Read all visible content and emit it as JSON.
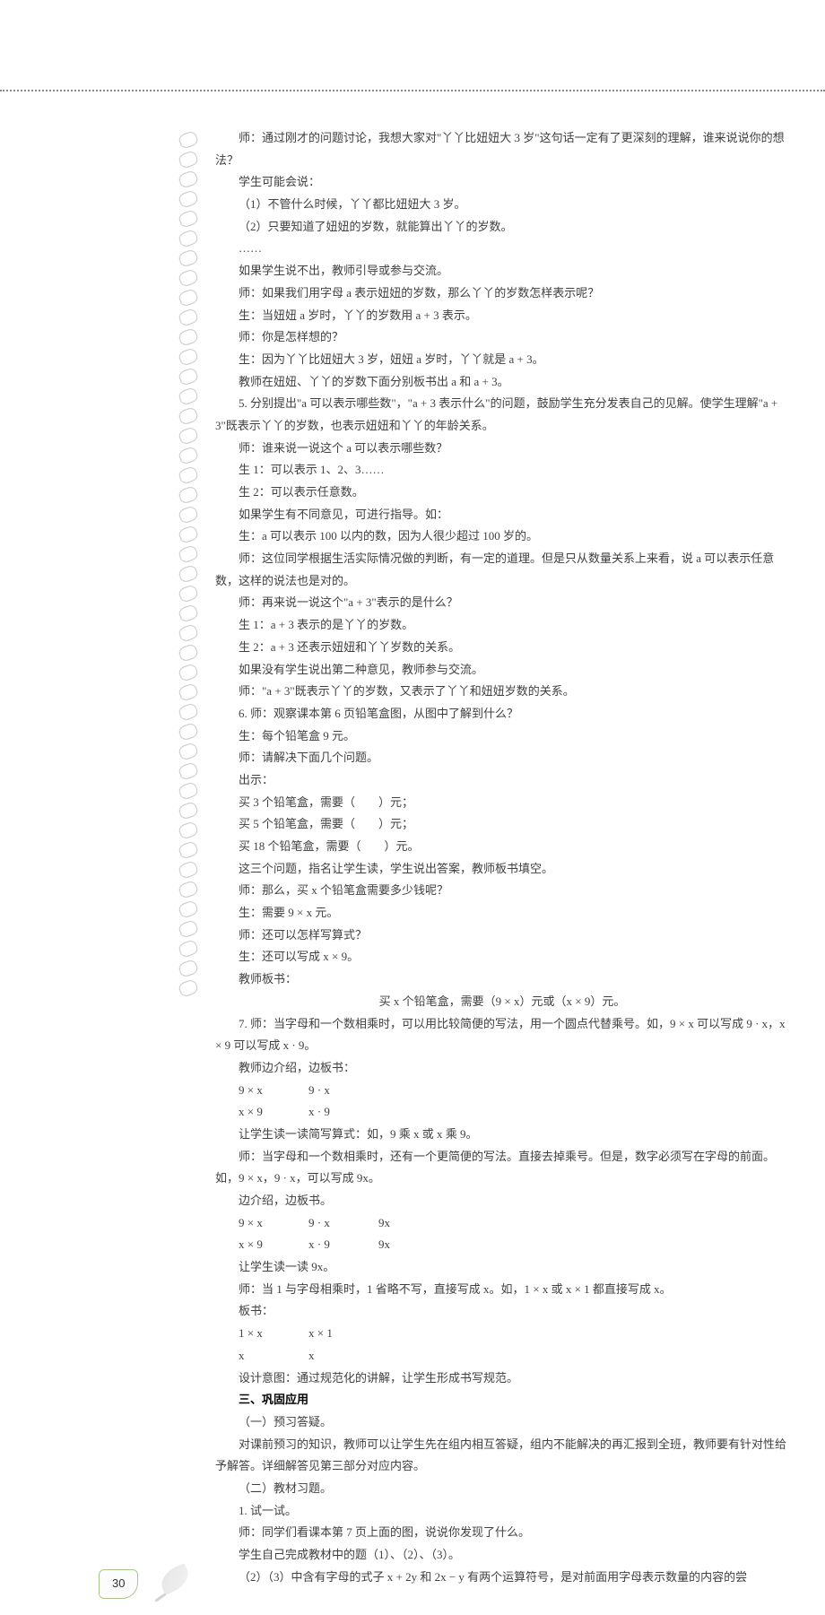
{
  "page_number": "30",
  "lines": {
    "l1": "师：通过刚才的问题讨论，我想大家对\"丫丫比妞妞大 3 岁\"这句话一定有了更深刻的理解，谁来说说你的想法？",
    "l2": "学生可能会说：",
    "l3": "（1）不管什么时候，丫丫都比妞妞大 3 岁。",
    "l4": "（2）只要知道了妞妞的岁数，就能算出丫丫的岁数。",
    "l5": "……",
    "l6": "如果学生说不出，教师引导或参与交流。",
    "l7": "师：如果我们用字母 a 表示妞妞的岁数，那么丫丫的岁数怎样表示呢？",
    "l8": "生：当妞妞 a 岁时，丫丫的岁数用 a + 3 表示。",
    "l9": "师：你是怎样想的？",
    "l10": "生：因为丫丫比妞妞大 3 岁，妞妞 a 岁时，丫丫就是 a + 3。",
    "l11": "教师在妞妞、丫丫的岁数下面分别板书出 a 和 a + 3。",
    "l12": "5. 分别提出\"a 可以表示哪些数\"，\"a + 3 表示什么\"的问题，鼓励学生充分发表自己的见解。使学生理解\"a + 3\"既表示丫丫的岁数，也表示妞妞和丫丫的年龄关系。",
    "l13": "师：谁来说一说这个 a 可以表示哪些数？",
    "l14": "生 1：可以表示 1、2、3……",
    "l15": "生 2：可以表示任意数。",
    "l16": "如果学生有不同意见，可进行指导。如：",
    "l17": "生：a 可以表示 100 以内的数，因为人很少超过 100 岁的。",
    "l18": "师：这位同学根据生活实际情况做的判断，有一定的道理。但是只从数量关系上来看，说 a 可以表示任意数，这样的说法也是对的。",
    "l19": "师：再来说一说这个\"a + 3\"表示的是什么？",
    "l20": "生 1：a + 3 表示的是丫丫的岁数。",
    "l21": "生 2：a + 3 还表示妞妞和丫丫岁数的关系。",
    "l22": "如果没有学生说出第二种意见，教师参与交流。",
    "l23": "师：\"a + 3\"既表示丫丫的岁数，又表示了丫丫和妞妞岁数的关系。",
    "l24": "6. 师：观察课本第 6 页铅笔盒图，从图中了解到什么？",
    "l25": "生：每个铅笔盒 9 元。",
    "l26": "师：请解决下面几个问题。",
    "l27": "出示：",
    "l28": "买 3 个铅笔盒，需要（　　）元；",
    "l29": "买 5 个铅笔盒，需要（　　）元；",
    "l30": "买 18 个铅笔盒，需要（　　）元。",
    "l31": "这三个问题，指名让学生读，学生说出答案，教师板书填空。",
    "l32": "师：那么，买 x 个铅笔盒需要多少钱呢？",
    "l33": "生：需要 9 × x 元。",
    "l34": "师：还可以怎样写算式？",
    "l35": "生：还可以写成 x × 9。",
    "l36": "教师板书：",
    "l37": "买 x 个铅笔盒，需要（9 × x）元或（x × 9）元。",
    "l38": "7. 师：当字母和一个数相乘时，可以用比较简便的写法，用一个圆点代替乘号。如，9 × x 可以写成 9 · x，x × 9 可以写成 x · 9。",
    "l39": "教师边介绍，边板书：",
    "row1a": "9 × x",
    "row1b": "9 · x",
    "row2a": "x × 9",
    "row2b": "x · 9",
    "l40": "让学生读一读简写算式：如，9 乘 x 或 x 乘 9。",
    "l41": "师：当字母和一个数相乘时，还有一个更简便的写法。直接去掉乘号。但是，数字必须写在字母的前面。如，9 × x，9 · x，可以写成 9x。",
    "l42": "边介绍，边板书。",
    "row3a": "9 × x",
    "row3b": "9 · x",
    "row3c": "9x",
    "row4a": "x × 9",
    "row4b": "x · 9",
    "row4c": "9x",
    "l43": "让学生读一读 9x。",
    "l44": "师：当 1 与字母相乘时，1 省略不写，直接写成 x。如，1 × x 或 x × 1 都直接写成 x。",
    "l45": "板书：",
    "row5a": "1 × x",
    "row5b": "x × 1",
    "row6a": "x",
    "row6b": "x",
    "l46": "设计意图：通过规范化的讲解，让学生形成书写规范。",
    "sec3": "三、巩固应用",
    "l47": "（一）预习答疑。",
    "l48": "对课前预习的知识，教师可以让学生先在组内相互答疑，组内不能解决的再汇报到全班，教师要有针对性给予解答。详细解答见第三部分对应内容。",
    "l49": "（二）教材习题。",
    "l50": "1. 试一试。",
    "l51": "师：同学们看课本第 7 页上面的图，说说你发现了什么。",
    "l52": "学生自己完成教材中的题（1）、（2）、（3）。",
    "l53": "（2）（3）中含有字母的式子 x + 2y 和 2x − y 有两个运算符号，是对前面用字母表示数量的内容的尝"
  }
}
